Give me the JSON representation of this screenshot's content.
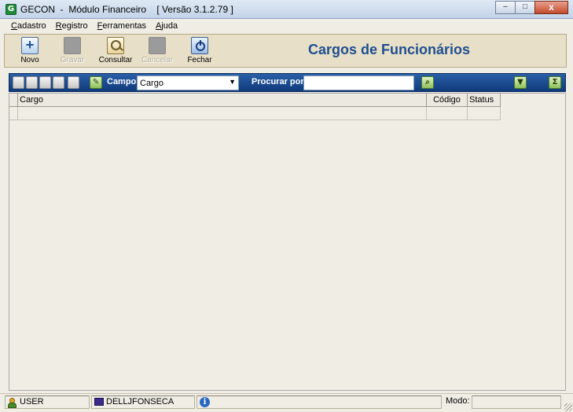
{
  "window": {
    "title": "GECON  -  Módulo Financeiro    [ Versão 3.1.2.79 ]",
    "app_icon_letter": "G",
    "controls": {
      "minimize": "–",
      "maximize": "□",
      "close": "x"
    }
  },
  "menu": [
    {
      "u": "C",
      "rest": "adastro"
    },
    {
      "u": "R",
      "rest": "egistro"
    },
    {
      "u": "F",
      "rest": "erramentas"
    },
    {
      "u": "A",
      "rest": "juda"
    }
  ],
  "toolbar": {
    "novo": "Novo",
    "gravar": "Gravar",
    "consultar": "Consultar",
    "cancelar": "Cancelar",
    "fechar": "Fechar"
  },
  "page_title": "Cargos de Funcionários",
  "search": {
    "campo_label": "Campo",
    "campo_value": "Cargo",
    "procurar_label": "Procurar por",
    "search_value": "",
    "filter_icon": "funnel-icon",
    "sum_icon": "sigma-icon",
    "sum_glyph": "Σ"
  },
  "grid": {
    "columns": [
      "Cargo",
      "Código",
      "Status"
    ],
    "rows": [
      [
        "",
        "",
        ""
      ]
    ]
  },
  "status": {
    "user": "USER",
    "computer": "DELLJFONSECA",
    "info_glyph": "i",
    "modo_label": "Modo:",
    "modo_value": ""
  },
  "colors": {
    "accent_title": "#1e4f8f",
    "search_bar": "#1a4a90",
    "toolbar_bg": "#e8dfc8"
  }
}
